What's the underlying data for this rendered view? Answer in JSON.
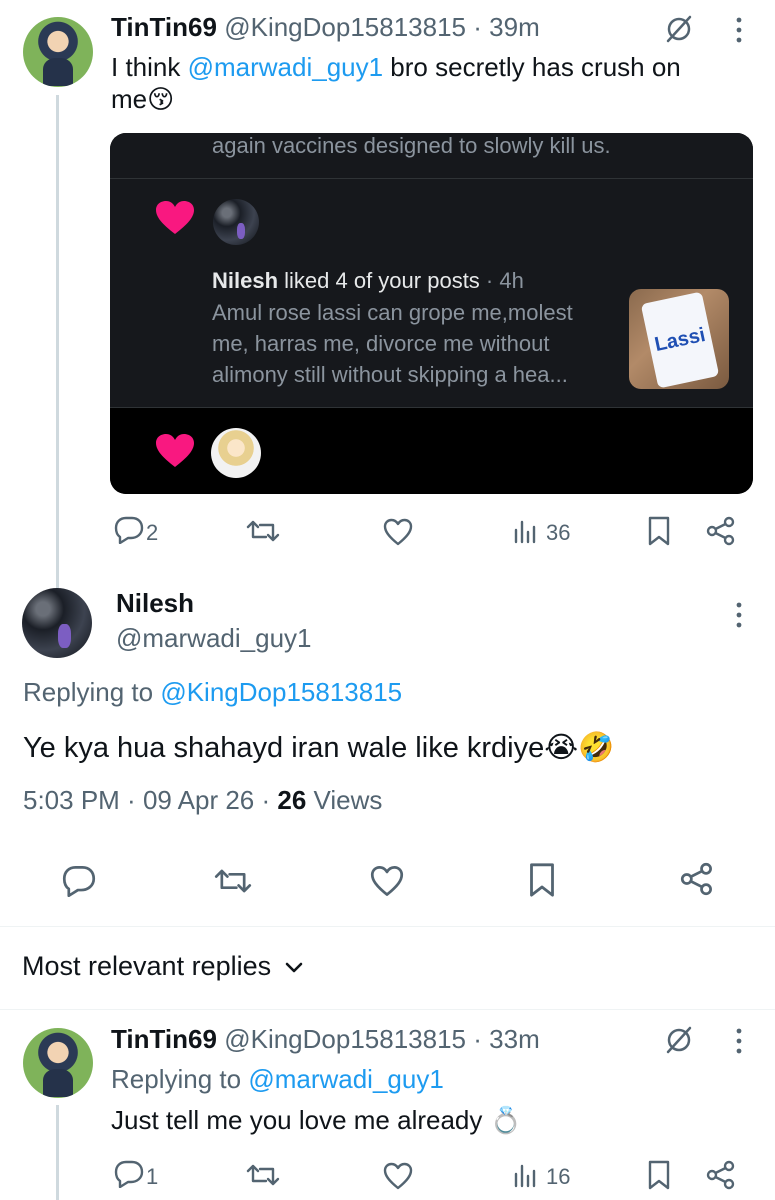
{
  "tweet1": {
    "name": "TinTin69",
    "handle": "@KingDop15813815",
    "dot": "·",
    "time": "39m",
    "text_before": "I think ",
    "mention": "@marwadi_guy1",
    "text_after": " bro secretly has crush on",
    "text_line2": "me",
    "emoji": "😚",
    "card": {
      "top_text": "again vaccines designed to slowly kill us.",
      "notif_name": "Nilesh",
      "notif_action": " liked 4 of your posts",
      "notif_dot": " · ",
      "notif_time": "4h",
      "notif_desc_1": "Amul rose lassi can grope me,molest",
      "notif_desc_2": "me, harras me, divorce me without",
      "notif_desc_3": "alimony still without skipping a hea...",
      "thumb_text": "Lassi"
    },
    "actions": {
      "replies": "2",
      "views": "36"
    }
  },
  "main_tweet": {
    "name": "Nilesh",
    "handle": "@marwadi_guy1",
    "replying_label": "Replying to ",
    "replying_to": "@KingDop15813815",
    "text": "Ye kya hua shahayd iran wale like krdiye",
    "emoji": "😭🤣",
    "time": "5:03 PM",
    "dot1": " · ",
    "date": "09 Apr 26",
    "dot2": " · ",
    "views_count": "26",
    "views_label": " Views"
  },
  "sort": {
    "label": "Most relevant replies"
  },
  "reply1": {
    "name": "TinTin69",
    "handle": "@KingDop15813815",
    "dot": "·",
    "time": "33m",
    "replying_label": "Replying to ",
    "replying_to": "@marwadi_guy1",
    "text": "Just tell me you love me already ",
    "emoji": "💍",
    "actions": {
      "replies": "1",
      "views": "16"
    }
  },
  "colors": {
    "link": "#1d9bf0",
    "muted": "#536471",
    "heart": "#f91880",
    "card_bg": "#000000",
    "card_row": "#16181c"
  },
  "icons": [
    "grok-slash-icon",
    "more-dots-icon",
    "reply-icon",
    "retweet-icon",
    "like-icon",
    "views-icon",
    "bookmark-icon",
    "share-icon",
    "heart-filled-icon",
    "chevron-down-icon"
  ]
}
